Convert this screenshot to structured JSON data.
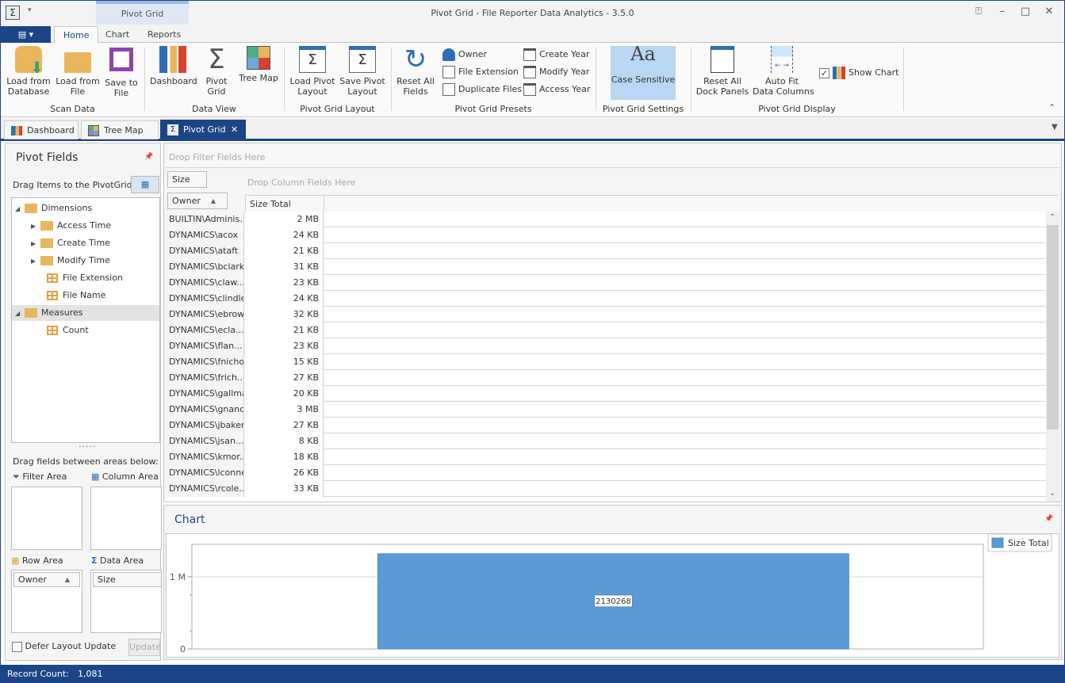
{
  "window": {
    "title": "Pivot Grid - File Reporter Data Analytics - 3.5.0",
    "context_group": "Pivot Grid"
  },
  "ribbon_tabs": [
    {
      "label": "Home"
    },
    {
      "label": "Chart"
    },
    {
      "label": "Reports"
    }
  ],
  "ribbon": {
    "scan_data": {
      "label": "Scan Data",
      "load_db": "Load from\nDatabase",
      "load_file": "Load from\nFile",
      "save_file": "Save to\nFile"
    },
    "data_view": {
      "label": "Data View",
      "dashboard": "Dashboard",
      "pivot": "Pivot\nGrid",
      "treemap": "Tree Map"
    },
    "layout": {
      "label": "Pivot Grid Layout",
      "load": "Load Pivot\nLayout",
      "save": "Save Pivot\nLayout"
    },
    "presets": {
      "label": "Pivot Grid Presets",
      "reset": "Reset All\nFields",
      "owner": "Owner",
      "ext": "File Extension",
      "dup": "Duplicate Files",
      "create": "Create Year",
      "modify": "Modify Year",
      "access": "Access Year"
    },
    "settings": {
      "label": "Pivot Grid Settings",
      "case": "Case Sensitive"
    },
    "display": {
      "label": "Pivot Grid Display",
      "reset_dock": "Reset All\nDock Panels",
      "autofit": "Auto Fit\nData Columns",
      "show_chart": "Show Chart",
      "show_chart_checked": true
    }
  },
  "doc_tabs": [
    {
      "label": "Dashboard"
    },
    {
      "label": "Tree Map"
    },
    {
      "label": "Pivot Grid"
    }
  ],
  "pivot_fields": {
    "title": "Pivot Fields",
    "drag_hint": "Drag Items to the PivotGrid",
    "tree": [
      "Dimensions",
      "Access Time",
      "Create Time",
      "Modify Time",
      "File Extension",
      "File Name",
      "Measures",
      "Count"
    ],
    "areas_hint": "Drag fields between areas below:",
    "filter_area": "Filter Area",
    "column_area": "Column Area",
    "row_area": "Row Area",
    "data_area": "Data Area",
    "row_field": "Owner",
    "data_field": "Size",
    "defer": "Defer Layout Update",
    "update": "Update"
  },
  "grid": {
    "filter_placeholder": "Drop Filter Fields Here",
    "column_placeholder": "Drop Column Fields Here",
    "data_field": "Size",
    "row_field": "Owner",
    "value_header": "Size Total",
    "rows": [
      [
        "BUILTIN\\Adminis...",
        "2 MB"
      ],
      [
        "DYNAMICS\\acox",
        "24 KB"
      ],
      [
        "DYNAMICS\\ataft",
        "21 KB"
      ],
      [
        "DYNAMICS\\bclark",
        "31 KB"
      ],
      [
        "DYNAMICS\\claw...",
        "23 KB"
      ],
      [
        "DYNAMICS\\clindley",
        "24 KB"
      ],
      [
        "DYNAMICS\\ebrown",
        "32 KB"
      ],
      [
        "DYNAMICS\\ecla...",
        "21 KB"
      ],
      [
        "DYNAMICS\\flan...",
        "23 KB"
      ],
      [
        "DYNAMICS\\fnichols",
        "15 KB"
      ],
      [
        "DYNAMICS\\frich...",
        "27 KB"
      ],
      [
        "DYNAMICS\\gallman",
        "20 KB"
      ],
      [
        "DYNAMICS\\gnance",
        "3 MB"
      ],
      [
        "DYNAMICS\\jbaker",
        "27 KB"
      ],
      [
        "DYNAMICS\\jsan...",
        "8 KB"
      ],
      [
        "DYNAMICS\\kmor...",
        "18 KB"
      ],
      [
        "DYNAMICS\\lconner",
        "26 KB"
      ],
      [
        "DYNAMICS\\rcole...",
        "33 KB"
      ]
    ]
  },
  "chart_panel": {
    "title": "Chart"
  },
  "chart_data": {
    "type": "bar",
    "categories": [
      ""
    ],
    "series": [
      {
        "name": "Size Total",
        "values": [
          2130268
        ]
      }
    ],
    "data_labels": [
      "2130268"
    ],
    "ytick_labels": [
      "0",
      "1 M"
    ],
    "yticks": [
      0,
      1000000
    ],
    "ylim": [
      0,
      1450000
    ],
    "grid": true,
    "legend": "top-right",
    "color": "#5b9bd5"
  },
  "status": {
    "label": "Record Count:",
    "value": "1,081"
  },
  "colors": {
    "accent": "#1c4587",
    "bar": "#5b9bd5",
    "selected": "#b7d7f2"
  }
}
